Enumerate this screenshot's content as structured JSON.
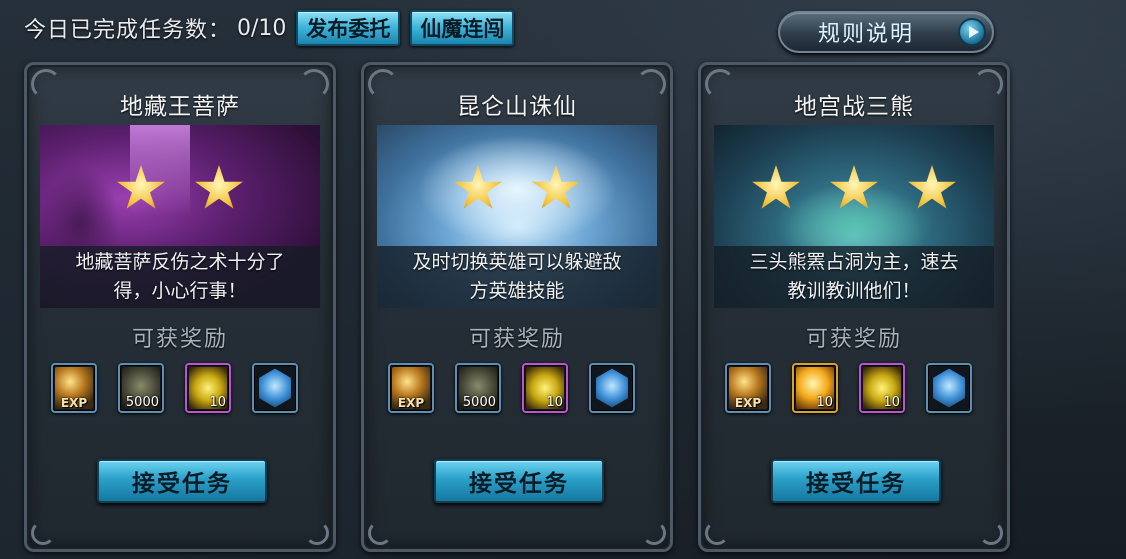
{
  "header": {
    "completed_label": "今日已完成任务数：",
    "completed_value": "0/10",
    "publish_button": "发布委托",
    "challenge_button": "仙魔连闯",
    "rules_button": "规则说明"
  },
  "cards": [
    {
      "title": "地藏王菩萨",
      "stars": 2,
      "desc_line1": "地藏菩萨反伤之术十分了",
      "desc_line2": "得，小心行事！",
      "reward_title": "可获奖励",
      "rewards": [
        {
          "icon": "exp-icon",
          "label": "EXP"
        },
        {
          "icon": "bag-icon",
          "label": "5000"
        },
        {
          "icon": "crystal-icon",
          "label": "10"
        },
        {
          "icon": "shield-icon",
          "label": ""
        }
      ],
      "accept_button": "接受任务"
    },
    {
      "title": "昆仑山诛仙",
      "stars": 2,
      "desc_line1": "及时切换英雄可以躲避敌",
      "desc_line2": "方英雄技能",
      "reward_title": "可获奖励",
      "rewards": [
        {
          "icon": "exp-icon",
          "label": "EXP"
        },
        {
          "icon": "bag-icon",
          "label": "5000"
        },
        {
          "icon": "crystal-icon",
          "label": "10"
        },
        {
          "icon": "shield-icon",
          "label": ""
        }
      ],
      "accept_button": "接受任务"
    },
    {
      "title": "地宫战三熊",
      "stars": 3,
      "desc_line1": "三头熊罴占洞为主，速去",
      "desc_line2": "教训教训他们！",
      "reward_title": "可获奖励",
      "rewards": [
        {
          "icon": "exp-icon",
          "label": "EXP"
        },
        {
          "icon": "orb-icon",
          "label": "10"
        },
        {
          "icon": "crystal-icon",
          "label": "10"
        },
        {
          "icon": "shield-icon",
          "label": ""
        }
      ],
      "accept_button": "接受任务"
    }
  ]
}
